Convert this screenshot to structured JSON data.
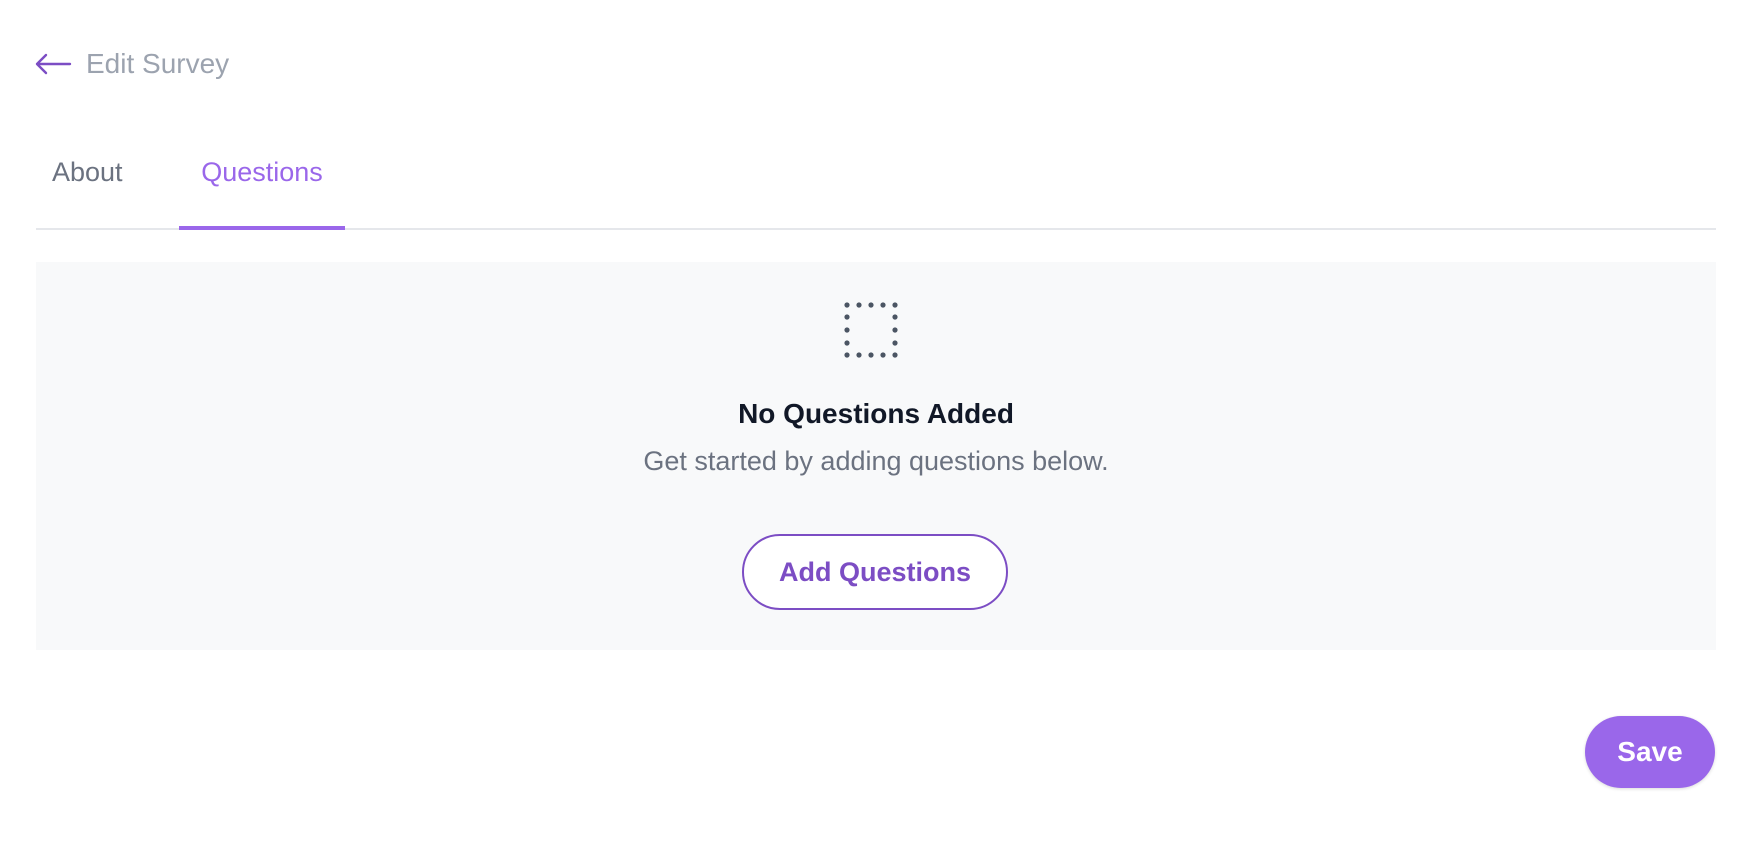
{
  "header": {
    "title": "Edit Survey",
    "back_icon": "arrow-left-icon"
  },
  "tabs": [
    {
      "label": "About",
      "active": false
    },
    {
      "label": "Questions",
      "active": true
    }
  ],
  "empty_state": {
    "icon": "dotted-square-icon",
    "title": "No Questions Added",
    "description": "Get started by adding questions below.",
    "button_label": "Add Questions"
  },
  "footer": {
    "save_label": "Save"
  },
  "colors": {
    "accent": "#9a67ea",
    "accent_dark": "#7c4dc4",
    "muted_text": "#6b7280",
    "panel_bg": "#f8f9fa"
  }
}
